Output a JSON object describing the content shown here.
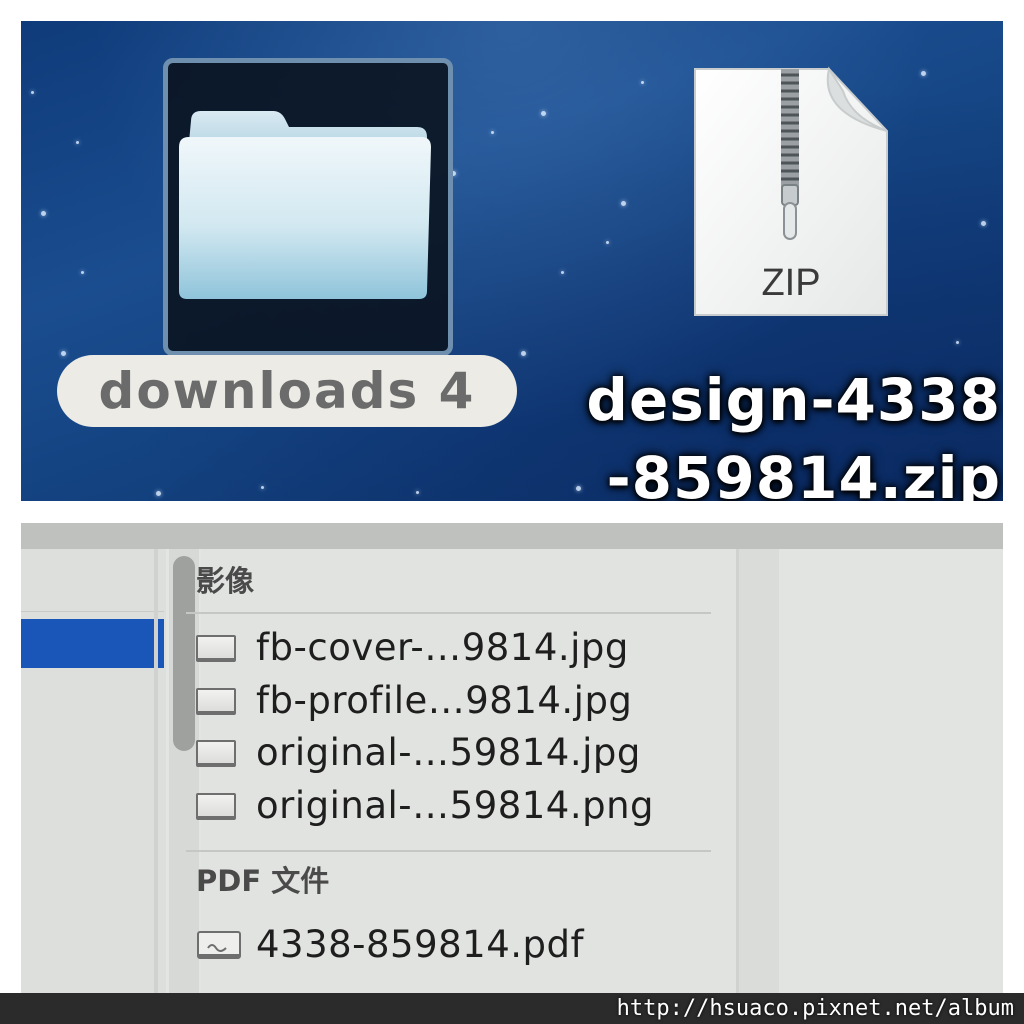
{
  "desktop": {
    "folder": {
      "icon": "folder-icon",
      "label": "downloads 4"
    },
    "zip": {
      "icon": "zip-file-icon",
      "badge": "ZIP",
      "label_line1": "design-4338",
      "label_line2": "-859814.zip"
    }
  },
  "finder": {
    "groups": [
      {
        "header": "影像",
        "items": [
          {
            "name": "fb-cover-…9814.jpg",
            "icon": "image-document-icon"
          },
          {
            "name": "fb-profile…9814.jpg",
            "icon": "image-document-icon"
          },
          {
            "name": "original-…59814.jpg",
            "icon": "image-document-icon"
          },
          {
            "name": "original-…59814.png",
            "icon": "image-document-icon"
          }
        ]
      },
      {
        "header": "PDF 文件",
        "items": [
          {
            "name": "4338-859814.pdf",
            "icon": "pdf-document-icon"
          }
        ]
      }
    ]
  },
  "watermark": "http://hsuaco.pixnet.net/album",
  "colors": {
    "desktop_blue": "#123f7c",
    "selection_blue": "#1a56b8",
    "label_pill": "#ecebe6"
  }
}
